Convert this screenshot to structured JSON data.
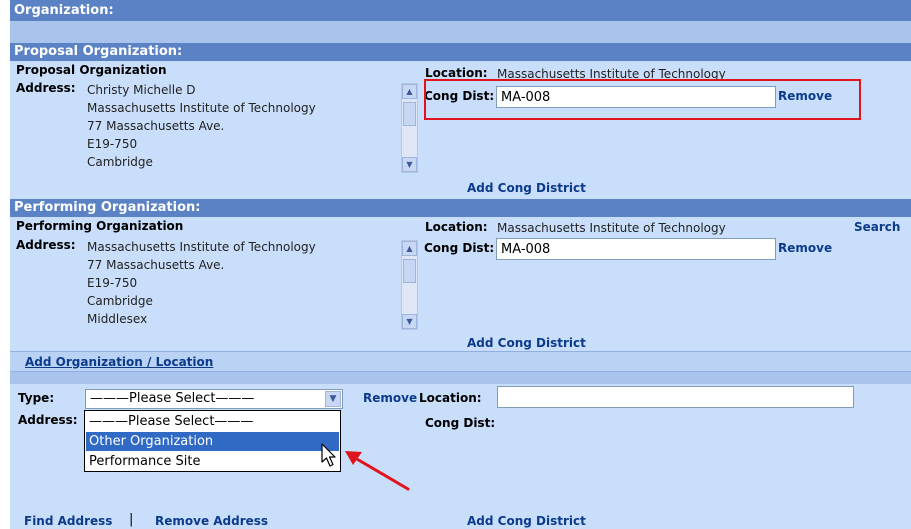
{
  "organization": {
    "header": "Organization:"
  },
  "proposal": {
    "header": "Proposal Organization:",
    "title": "Proposal Organization",
    "address_label": "Address:",
    "address_lines": [
      "Christy Michelle D",
      "Massachusetts Institute of Technology",
      "77 Massachusetts Ave.",
      "E19-750",
      "Cambridge"
    ],
    "location_label": "Location:",
    "location_value": "Massachusetts Institute of Technology",
    "cong_dist_label": "Cong Dist:",
    "cong_dist_value": "MA-008",
    "remove_label": "Remove",
    "add_cong_district": "Add Cong District"
  },
  "performing": {
    "header": "Performing Organization:",
    "title": "Performing Organization",
    "address_label": "Address:",
    "address_lines": [
      "Massachusetts Institute of Technology",
      "77 Massachusetts Ave.",
      "E19-750",
      "Cambridge",
      "Middlesex"
    ],
    "location_label": "Location:",
    "location_value": "Massachusetts Institute of Technology",
    "search_label": "Search",
    "cong_dist_label": "Cong Dist:",
    "cong_dist_value": "MA-008",
    "remove_label": "Remove",
    "add_cong_district": "Add Cong District"
  },
  "add_org": {
    "link": "Add Organization / Location",
    "type_label": "Type:",
    "address_label": "Address:",
    "select_value": "———Please Select———",
    "options": [
      "———Please Select———",
      "Other Organization",
      "Performance Site"
    ],
    "highlighted_option": "Other Organization",
    "remove_label": "Remove",
    "location_label": "Location:",
    "location_value": "",
    "cong_dist_label": "Cong Dist:",
    "find_address": "Find Address",
    "separator": "|",
    "remove_address": "Remove Address",
    "add_cong_district": "Add Cong District"
  },
  "colors": {
    "header_band": "#5a82c5",
    "panel": "#c9defa",
    "link": "#0d3b8c",
    "highlight": "#316ac5",
    "annotation": "#e0141c"
  }
}
